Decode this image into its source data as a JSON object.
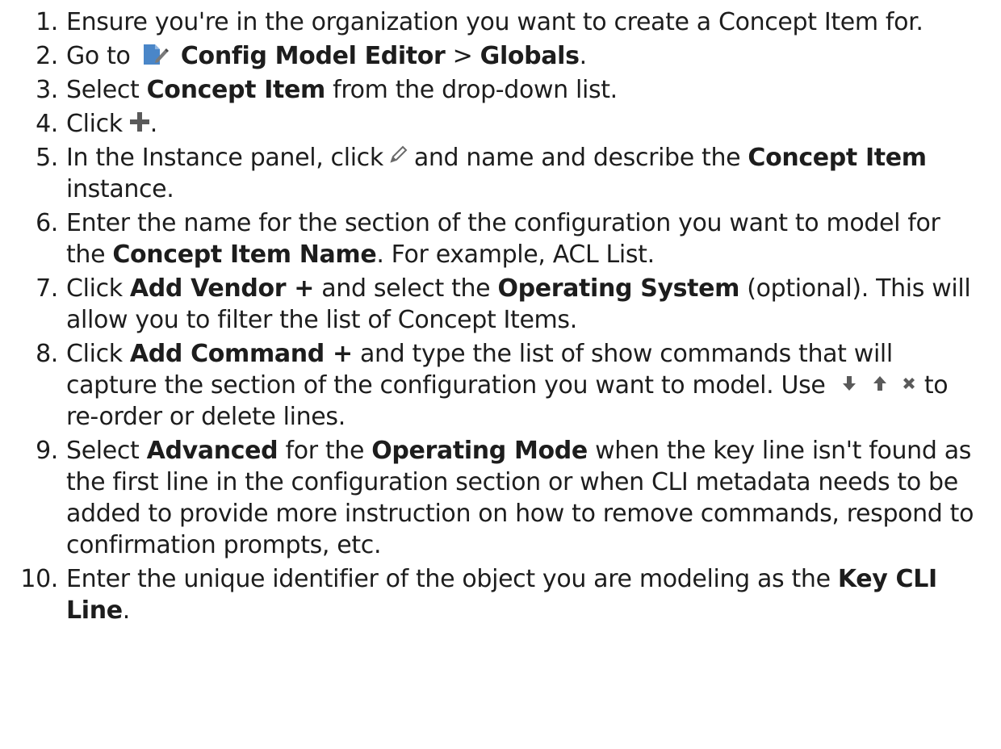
{
  "steps": [
    {
      "num": "1.",
      "t1": "Ensure you're in the organization you want to create a Concept Item for."
    },
    {
      "num": "2.",
      "t1": "Go to",
      "b1": "Config Model Editor",
      "t2": " > ",
      "b2": "Globals",
      "t3": "."
    },
    {
      "num": "3.",
      "t1": "Select ",
      "b1": "Concept Item",
      "t2": " from the drop-down list."
    },
    {
      "num": "4.",
      "t1": "Click",
      "t2": "."
    },
    {
      "num": "5.",
      "t1": "In the Instance panel, click",
      "t2": "and name and describe the ",
      "b1": "Concept Item",
      "t3": " instance."
    },
    {
      "num": "6.",
      "t1": "Enter the name for the section of the configuration you want to model for the ",
      "b1": "Concept Item Name",
      "t2": ". For example, ACL List."
    },
    {
      "num": "7.",
      "t1": "Click ",
      "b1": "Add Vendor +",
      "t2": " and select the ",
      "b2": "Operating System",
      "t3": " (optional). This will allow you to filter the list of Concept Items."
    },
    {
      "num": "8.",
      "t1": "Click ",
      "b1": "Add Command +",
      "t2": " and type the list of show commands that will capture the section of the configuration you want to model. Use",
      "t3": "to re-order or delete lines."
    },
    {
      "num": "9.",
      "t1": "Select ",
      "b1": "Advanced",
      "t2": " for the ",
      "b2": "Operating Mode",
      "t3": " when the key line isn't found as the first line in the configuration section or when CLI metadata needs to be added to provide more instruction on how to remove commands,  respond to confirmation prompts, etc."
    },
    {
      "num": "10.",
      "t1": "Enter the unique identifier of the object you are modeling as the ",
      "b1": "Key CLI Line",
      "t2": "."
    }
  ],
  "icons": {
    "config_model_editor": "edit-page-icon",
    "add": "plus-icon",
    "edit": "pencil-icon",
    "move_down": "arrow-down-icon",
    "move_up": "arrow-up-icon",
    "delete": "x-icon"
  },
  "colors": {
    "text": "#1d1d1d",
    "icon_gray": "#5a5a5a",
    "editor_icon_blue": "#4a86c8"
  }
}
